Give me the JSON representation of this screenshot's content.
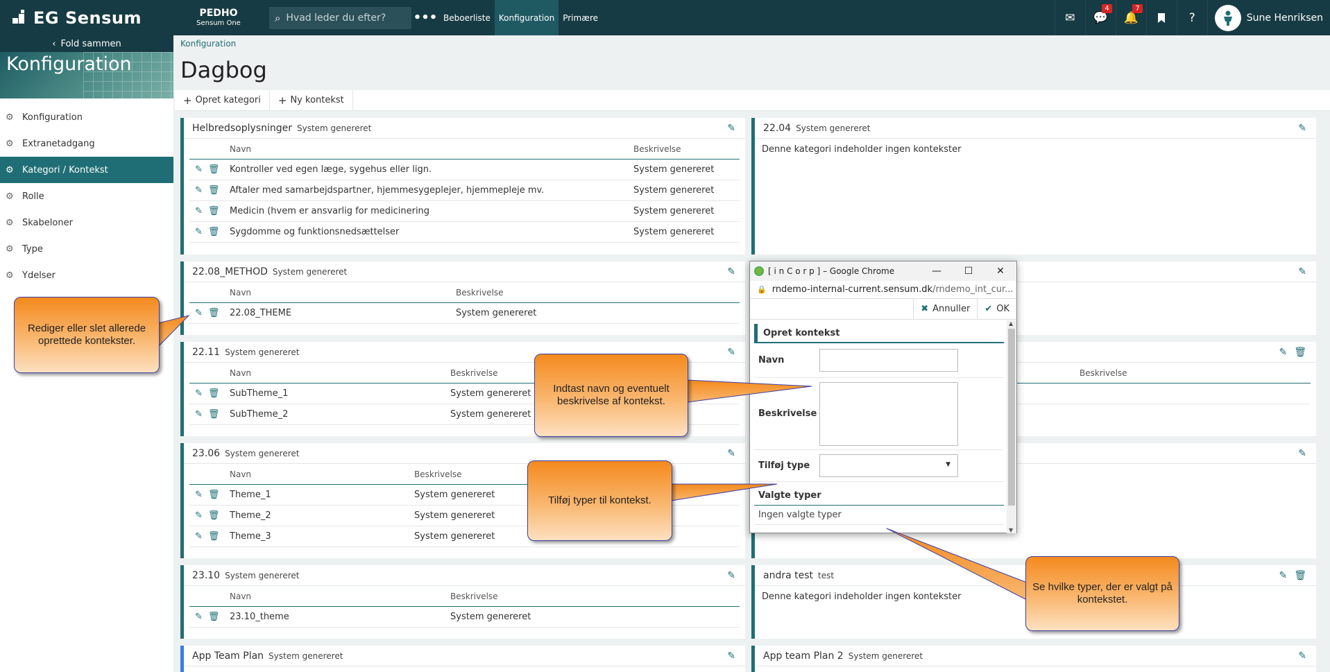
{
  "topbar": {
    "logo_text": "EG Sensum",
    "brand_name": "PEDHO",
    "brand_sub": "Sensum One",
    "search_placeholder": "Hvad leder du efter?",
    "more": "•••",
    "nav": [
      "Beboerliste",
      "Konfiguration",
      "Primære"
    ],
    "active_nav": "Konfiguration",
    "messages_badge": "4",
    "notifications_badge": "7",
    "help": "?",
    "user_name": "Sune Henriksen"
  },
  "sidebar": {
    "fold_label": "Fold sammen",
    "hero_title": "Konfiguration",
    "items": [
      "Konfiguration",
      "Extranetadgang",
      "Kategori / Kontekst",
      "Rolle",
      "Skabeloner",
      "Type",
      "Ydelser"
    ],
    "active_item": "Kategori / Kontekst"
  },
  "page": {
    "breadcrumb": "Konfiguration",
    "title": "Dagbog",
    "toolbar": [
      "Opret kategori",
      "Ny kontekst"
    ]
  },
  "cards": {
    "helbred": {
      "title": "Helbredsoplysninger",
      "sub": "System genereret",
      "col_name": "Navn",
      "col_desc": "Beskrivelse",
      "rows": [
        {
          "name": "Kontroller ved egen læge, sygehus eller lign.",
          "desc": "System genereret"
        },
        {
          "name": "Aftaler med samarbejdspartner, hjemmesygeplejer, hjemmepleje mv.",
          "desc": "System genereret"
        },
        {
          "name": "Medicin (hvem er ansvarlig for medicinering",
          "desc": "System genereret"
        },
        {
          "name": "Sygdomme og funktionsnedsættelser",
          "desc": "System genereret"
        }
      ]
    },
    "c2204": {
      "title": "22.04",
      "sub": "System genereret",
      "empty": "Denne kategori indeholder ingen kontekster"
    },
    "c2208": {
      "title": "22.08_METHOD",
      "sub": "System genereret",
      "col_name": "Navn",
      "col_desc": "Beskrivelse",
      "rows": [
        {
          "name": "22.08_THEME",
          "desc": "System genereret"
        }
      ]
    },
    "c2211": {
      "title": "22.11",
      "sub": "System genereret",
      "col_name": "Navn",
      "col_desc": "Beskrivelse",
      "rows": [
        {
          "name": "SubTheme_1",
          "desc": "System genereret"
        },
        {
          "name": "SubTheme_2",
          "desc": "System genereret"
        }
      ]
    },
    "right_col_desc": "Beskrivelse",
    "c2306": {
      "title": "23.06",
      "sub": "System genereret",
      "col_name": "Navn",
      "col_desc": "Beskrivelse",
      "rows": [
        {
          "name": "Theme_1",
          "desc": "System genereret"
        },
        {
          "name": "Theme_2",
          "desc": "System genereret"
        },
        {
          "name": "Theme_3",
          "desc": "System genereret"
        }
      ]
    },
    "c2310": {
      "title": "23.10",
      "sub": "System genereret",
      "col_name": "Navn",
      "col_desc": "Beskrivelse",
      "rows": [
        {
          "name": "23.10_theme",
          "desc": "System genereret"
        }
      ]
    },
    "andra": {
      "title": "andra test",
      "sub": "test",
      "empty": "Denne kategori indeholder ingen kontekster"
    },
    "appteam": {
      "title": "App Team Plan",
      "sub": "System genereret"
    },
    "appteam2": {
      "title": "App team Plan 2",
      "sub": "System genereret"
    }
  },
  "popup": {
    "window_title": "[ i n C o r p ] – Google Chrome",
    "url_host": "rndemo-internal-current.sensum.dk",
    "url_path": "/rndemo_int_cur...",
    "cancel_label": "Annuller",
    "ok_label": "OK",
    "form_title": "Opret kontekst",
    "name_label": "Navn",
    "desc_label": "Beskrivelse",
    "type_label": "Tilføj type",
    "selected_header": "Valgte typer",
    "selected_empty": "Ingen valgte typer"
  },
  "callouts": {
    "edit": "Rediger eller slet allerede oprettede kontekster.",
    "name": "Indtast navn og eventuelt beskrivelse af kontekst.",
    "types": "Tilføj typer til kontekst.",
    "selected": "Se hvilke typer, der er valgt på kontekstet."
  },
  "colors": {
    "topbar": "#173b44",
    "accent": "#1f6e75",
    "callout": "#f48a1e",
    "badge": "#d82424"
  }
}
